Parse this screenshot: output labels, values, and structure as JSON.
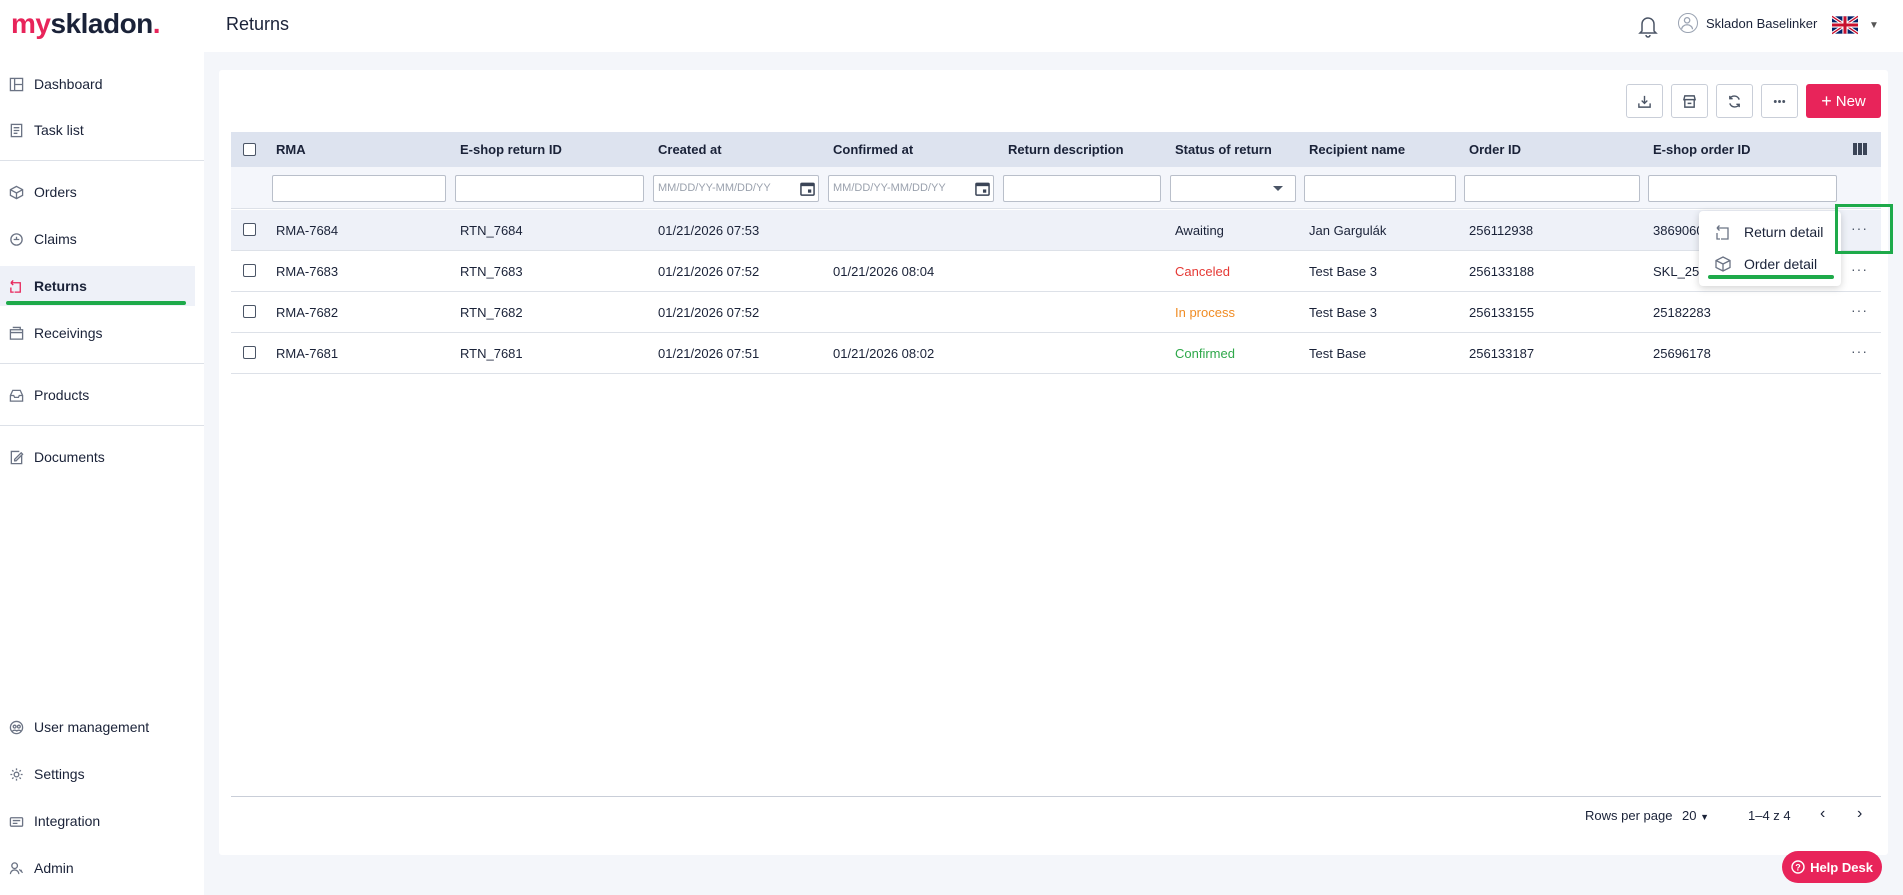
{
  "app": {
    "logo_my": "my",
    "logo_sk": "skladon",
    "logo_dot": ".",
    "page_title": "Returns",
    "user_name": "Skladon Baselinker"
  },
  "sidebar": {
    "items": [
      {
        "label": "Dashboard",
        "icon": "dashboard-icon"
      },
      {
        "label": "Task list",
        "icon": "task-list-icon"
      },
      {
        "label": "Orders",
        "icon": "cube-icon"
      },
      {
        "label": "Claims",
        "icon": "claims-icon"
      },
      {
        "label": "Returns",
        "icon": "returns-icon",
        "active": true
      },
      {
        "label": "Receivings",
        "icon": "receivings-icon"
      },
      {
        "label": "Products",
        "icon": "inbox-icon"
      },
      {
        "label": "Documents",
        "icon": "document-edit-icon"
      },
      {
        "label": "User management",
        "icon": "user-management-icon"
      },
      {
        "label": "Settings",
        "icon": "gear-icon"
      },
      {
        "label": "Integration",
        "icon": "integration-icon"
      },
      {
        "label": "Admin",
        "icon": "admin-icon"
      }
    ]
  },
  "toolbar": {
    "new_label": "New"
  },
  "table": {
    "columns": [
      "RMA",
      "E-shop return ID",
      "Created at",
      "Confirmed at",
      "Return description",
      "Status of return",
      "Recipient name",
      "Order ID",
      "E-shop order ID"
    ],
    "date_placeholder": "MM/DD/YY-MM/DD/YY",
    "rows": [
      {
        "rma": "RMA-7684",
        "eshop_return_id": "RTN_7684",
        "created_at": "01/21/2026 07:53",
        "confirmed_at": "",
        "description": "",
        "status": "Awaiting",
        "recipient": "Jan Gargulák",
        "order_id": "256112938",
        "eshop_order_id": "3869060"
      },
      {
        "rma": "RMA-7683",
        "eshop_return_id": "RTN_7683",
        "created_at": "01/21/2026 07:52",
        "confirmed_at": "01/21/2026 08:04",
        "description": "",
        "status": "Canceled",
        "recipient": "Test Base 3",
        "order_id": "256133188",
        "eshop_order_id": "SKL_25"
      },
      {
        "rma": "RMA-7682",
        "eshop_return_id": "RTN_7682",
        "created_at": "01/21/2026 07:52",
        "confirmed_at": "",
        "description": "",
        "status": "In process",
        "recipient": "Test Base 3",
        "order_id": "256133155",
        "eshop_order_id": "25182283"
      },
      {
        "rma": "RMA-7681",
        "eshop_return_id": "RTN_7681",
        "created_at": "01/21/2026 07:51",
        "confirmed_at": "01/21/2026 08:02",
        "description": "",
        "status": "Confirmed",
        "recipient": "Test Base",
        "order_id": "256133187",
        "eshop_order_id": "25696178"
      }
    ]
  },
  "context_menu": {
    "items": [
      "Return detail",
      "Order detail"
    ]
  },
  "pagination": {
    "rows_per_page_label": "Rows per page",
    "rows_per_page_value": "20",
    "range": "1–4 z 4"
  },
  "help_desk": {
    "label": "Help Desk"
  },
  "colors": {
    "accent": "#e8245a",
    "highlight_green": "#1eaa4a",
    "status_canceled": "#e53935",
    "status_in_process": "#f08c24",
    "status_confirmed": "#2ea84a"
  }
}
